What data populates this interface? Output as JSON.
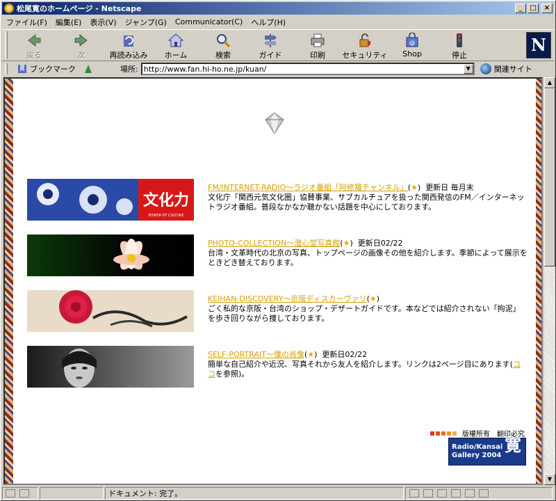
{
  "window": {
    "title": "松尾寛のホームページ - Netscape"
  },
  "menu": [
    "ファイル(F)",
    "編集(E)",
    "表示(V)",
    "ジャンプ(G)",
    "Communicator(C)",
    "ヘルプ(H)"
  ],
  "toolbar": {
    "back": "戻る",
    "forward": "次",
    "reload": "再読み込み",
    "home": "ホーム",
    "search": "検索",
    "guide": "ガイド",
    "print": "印刷",
    "security": "セキュリティ",
    "shop": "Shop",
    "stop": "停止",
    "logo": "N"
  },
  "location": {
    "bookmarks_label": "ブックマーク",
    "label": "場所:",
    "url": "http://www.fan.hi-ho.ne.jp/kuan/",
    "related": "関連サイト"
  },
  "entries": [
    {
      "link": "FM/INTERNET-RADIO～ラジオ番組「阿修羅チャンネル」",
      "star": "★",
      "update": "更新日 毎月末",
      "desc": "文化庁「関西元気文化圏」協賛事業、サブカルチュアを扱った関西発信のFM／インターネットラジオ番組。普段なかなか聴かない話題を中心にしております。",
      "banner_text": "文化力",
      "banner_sub": "POWER OF CULTURE"
    },
    {
      "link": "PHOTO-COLLECTION～澄心堂写真館",
      "star": "★",
      "update": "更新日02/22",
      "desc": "台湾・文革時代の北京の写真、トップページの画像その他を紹介します。季節によって展示をときどき替えております。"
    },
    {
      "link": "KEIHAN-DISCOVERY～京阪ディスカーヴァリ",
      "star": "★",
      "update": "",
      "desc": "ごく私的な京阪・台湾のショップ・デザートガイドです。本などでは紹介されない「拘泥」を歩き回りながら捜しております。"
    },
    {
      "link": "SELF-PORTRAIT～僕の肖像",
      "star": "★",
      "update": "更新日02/22",
      "desc_before": "簡単な自己紹介や近況、写真それから友人を紹介します。リンクは2ページ目にあります(",
      "desc_link": "ココ",
      "desc_after": "を参照)。"
    }
  ],
  "footer": {
    "rights": "版權所有　翻印必究",
    "logo_line1": "Radio/Kansai",
    "logo_line2": "Gallery 2004",
    "logo_kanji": "寛"
  },
  "status": {
    "text": "ドキュメント: 完了。"
  },
  "colors": {
    "link": "#d4a000",
    "title_bar": "#0a246a"
  }
}
